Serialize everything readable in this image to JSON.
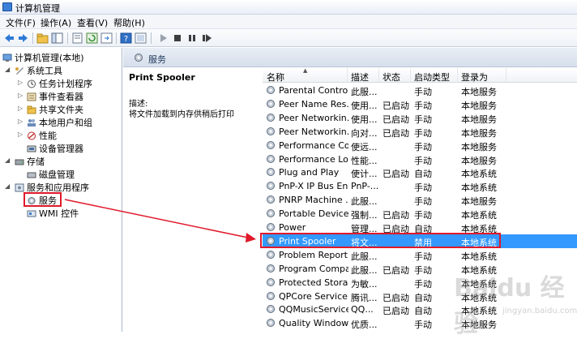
{
  "window": {
    "title": "计算机管理"
  },
  "menu": [
    "文件(F)",
    "操作(A)",
    "查看(V)",
    "帮助(H)"
  ],
  "tree": {
    "root": "计算机管理(本地)",
    "system_tools": "系统工具",
    "task_scheduler": "任务计划程序",
    "event_viewer": "事件查看器",
    "shared_folders": "共享文件夹",
    "local_users": "本地用户和组",
    "performance": "性能",
    "device_manager": "设备管理器",
    "storage": "存储",
    "disk_management": "磁盘管理",
    "services_apps": "服务和应用程序",
    "services": "服务",
    "wmi": "WMI 控件"
  },
  "content": {
    "header": "服务",
    "selected_title": "Print Spooler",
    "desc_label": "描述:",
    "desc_text": "将文件加载到内存供稍后打印"
  },
  "columns": [
    "名称",
    "描述",
    "状态",
    "启动类型",
    "登录为"
  ],
  "rows": [
    {
      "name": "Parental Controls",
      "desc": "此服...",
      "status": "",
      "startup": "手动",
      "logon": "本地服务"
    },
    {
      "name": "Peer Name Res...",
      "desc": "使用...",
      "status": "已启动",
      "startup": "手动",
      "logon": "本地服务"
    },
    {
      "name": "Peer Networkin...",
      "desc": "使用...",
      "status": "已启动",
      "startup": "手动",
      "logon": "本地服务"
    },
    {
      "name": "Peer Networkin...",
      "desc": "向对...",
      "status": "已启动",
      "startup": "手动",
      "logon": "本地服务"
    },
    {
      "name": "Performance Co...",
      "desc": "使远...",
      "status": "",
      "startup": "手动",
      "logon": "本地服务"
    },
    {
      "name": "Performance Lo...",
      "desc": "性能...",
      "status": "",
      "startup": "手动",
      "logon": "本地服务"
    },
    {
      "name": "Plug and Play",
      "desc": "使计...",
      "status": "已启动",
      "startup": "自动",
      "logon": "本地系统"
    },
    {
      "name": "PnP-X IP Bus En...",
      "desc": "PnP-...",
      "status": "",
      "startup": "手动",
      "logon": "本地系统"
    },
    {
      "name": "PNRP Machine ...",
      "desc": "此服...",
      "status": "",
      "startup": "手动",
      "logon": "本地服务"
    },
    {
      "name": "Portable Device ...",
      "desc": "强制...",
      "status": "已启动",
      "startup": "手动",
      "logon": "本地系统"
    },
    {
      "name": "Power",
      "desc": "管理...",
      "status": "已启动",
      "startup": "自动",
      "logon": "本地系统"
    },
    {
      "name": "Print Spooler",
      "desc": "将文...",
      "status": "",
      "startup": "禁用",
      "logon": "本地系统"
    },
    {
      "name": "Problem Report...",
      "desc": "此服...",
      "status": "",
      "startup": "手动",
      "logon": "本地系统"
    },
    {
      "name": "Program Compa...",
      "desc": "此服...",
      "status": "已启动",
      "startup": "手动",
      "logon": "本地系统"
    },
    {
      "name": "Protected Storage",
      "desc": "为敏...",
      "status": "",
      "startup": "手动",
      "logon": "本地系统"
    },
    {
      "name": "QPCore Service",
      "desc": "腾讯...",
      "status": "已启动",
      "startup": "自动",
      "logon": "本地系统"
    },
    {
      "name": "QQMusicService",
      "desc": "QQ...",
      "status": "已启动",
      "startup": "自动",
      "logon": "本地系统"
    },
    {
      "name": "Quality Windows...",
      "desc": "优质...",
      "status": "",
      "startup": "手动",
      "logon": "本地服务"
    }
  ],
  "selected_row": 11,
  "colors": {
    "accent": "#3399ff",
    "highlight": "#e0192b"
  },
  "watermark": {
    "main": "Baidu 经验",
    "sub": "jingyan.baidu.com"
  }
}
